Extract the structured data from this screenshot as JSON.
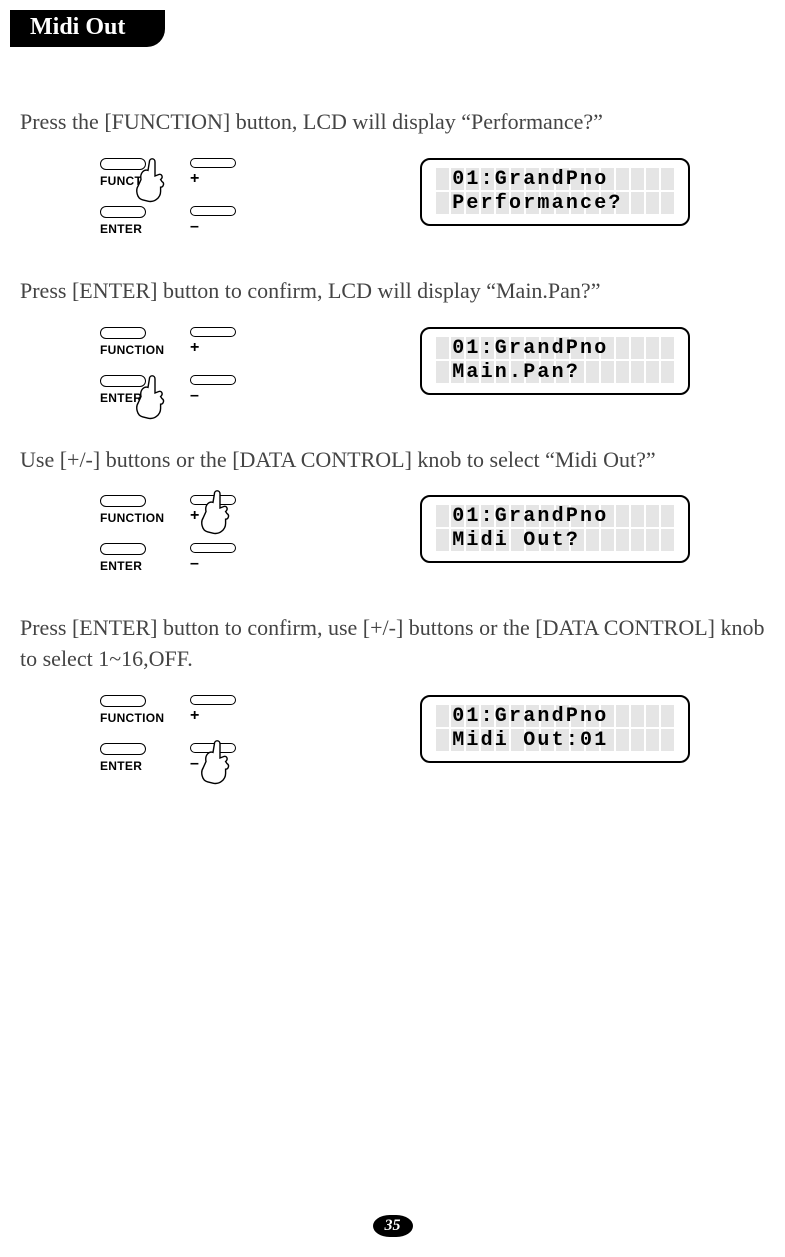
{
  "header": {
    "title": "Midi Out"
  },
  "steps": [
    {
      "instruction": "Press the [FUNCTION] button, LCD will display “Performance?”",
      "panel": {
        "topLeftLabel": "FUNCTI",
        "bottomLeftLabel": "ENTER",
        "plus": "+",
        "minus": "–"
      },
      "lcd": {
        "line1": " 01:GrandPno",
        "line2": " Performance?"
      },
      "pressTarget": "function"
    },
    {
      "instruction": "Press [ENTER] button to confirm, LCD will display “Main.Pan?”",
      "panel": {
        "topLeftLabel": "FUNCTION",
        "bottomLeftLabel": "ENTER",
        "plus": "+",
        "minus": "–"
      },
      "lcd": {
        "line1": " 01:GrandPno",
        "line2": " Main.Pan?"
      },
      "pressTarget": "enter"
    },
    {
      "instruction": "Use [+/-] buttons or the [DATA CONTROL] knob to select “Midi Out?”",
      "panel": {
        "topLeftLabel": "FUNCTION",
        "bottomLeftLabel": "ENTER",
        "plus": "+",
        "minus": "–"
      },
      "lcd": {
        "line1": " 01:GrandPno",
        "line2": " Midi Out?"
      },
      "pressTarget": "plus"
    },
    {
      "instruction": "Press [ENTER] button to confirm, use [+/-] buttons or the [DATA CONTROL] knob to select 1~16,OFF.",
      "panel": {
        "topLeftLabel": "FUNCTION",
        "bottomLeftLabel": "ENTER",
        "plus": "+",
        "minus": "–"
      },
      "lcd": {
        "line1": " 01:GrandPno",
        "line2": " Midi Out:01"
      },
      "pressTarget": "minus"
    }
  ],
  "pageNumber": "35"
}
